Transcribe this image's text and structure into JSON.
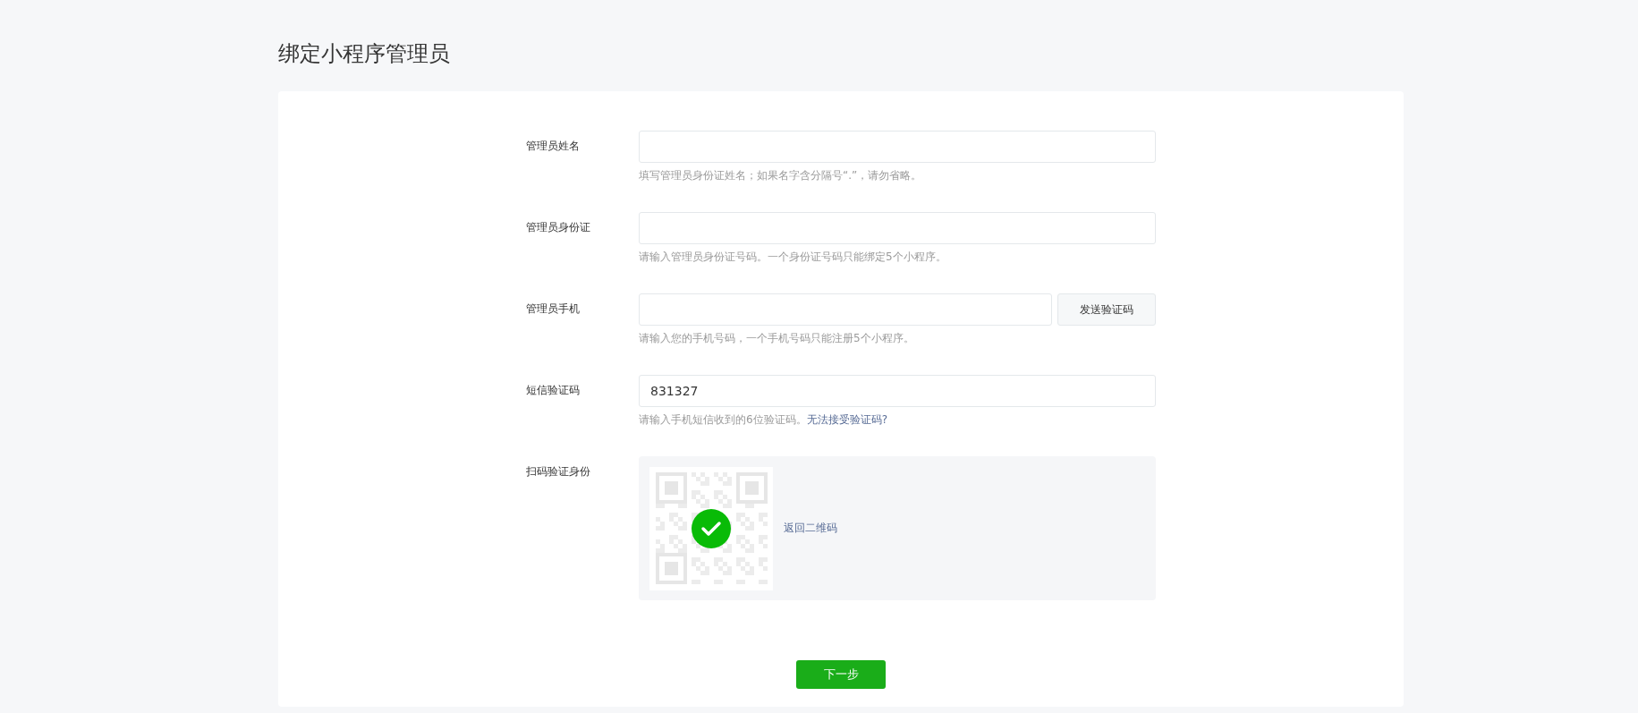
{
  "title": "绑定小程序管理员",
  "fields": [
    {
      "kind": "input",
      "label": "管理员姓名",
      "hint": "填写管理员身份证姓名；如果名字含分隔号“.”，请勿省略。"
    },
    {
      "kind": "input",
      "label": "管理员身份证",
      "hint": "请输入管理员身份证号码。一个身份证号码只能绑定5个小程序。"
    },
    {
      "kind": "input-button",
      "label": "管理员手机",
      "button": "发送验证码",
      "hint": "请输入您的手机号码，一个手机号码只能注册5个小程序。"
    },
    {
      "kind": "input",
      "label": "短信验证码",
      "value": "831327",
      "hint": "请输入手机短信收到的6位验证码。",
      "link": "无法接受验证码?"
    },
    {
      "kind": "qr",
      "label": "扫码验证身份",
      "verified": true,
      "link": "返回二维码"
    }
  ],
  "submit": "下一步"
}
